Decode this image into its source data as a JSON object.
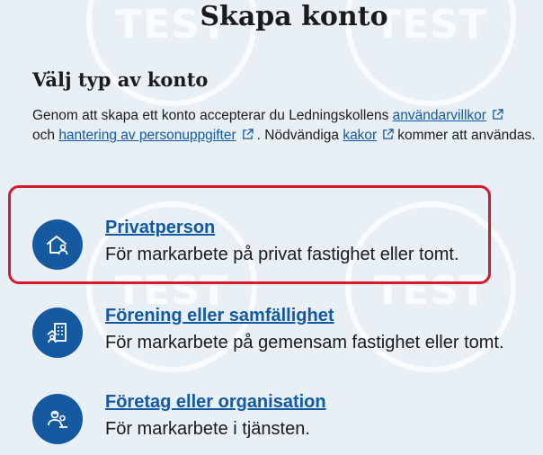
{
  "page": {
    "title": "Skapa konto",
    "watermark": "TEST"
  },
  "section": {
    "heading": "Välj typ av konto",
    "intro": {
      "part1": "Genom att skapa ett konto accepterar du Ledningskollens ",
      "link1": "användarvillkor",
      "part2": "och ",
      "link2": "hantering av personuppgifter",
      "part3": ". Nödvändiga ",
      "link3": "kakor",
      "part4": "kommer att användas."
    }
  },
  "options": [
    {
      "title": "Privatperson",
      "description": "För markarbete på privat fastighet eller tomt.",
      "icon": "house-person-icon"
    },
    {
      "title": "Förening eller samfällighet",
      "description": "För markarbete på gemensam fastighet eller tomt.",
      "icon": "building-person-icon"
    },
    {
      "title": "Företag eller organisation",
      "description": "För markarbete i tjänsten.",
      "icon": "worker-group-icon"
    }
  ],
  "colors": {
    "background": "#e8f0f5",
    "link": "#1259a3",
    "icon_bg": "#155aa0",
    "highlight": "#d7192a"
  }
}
